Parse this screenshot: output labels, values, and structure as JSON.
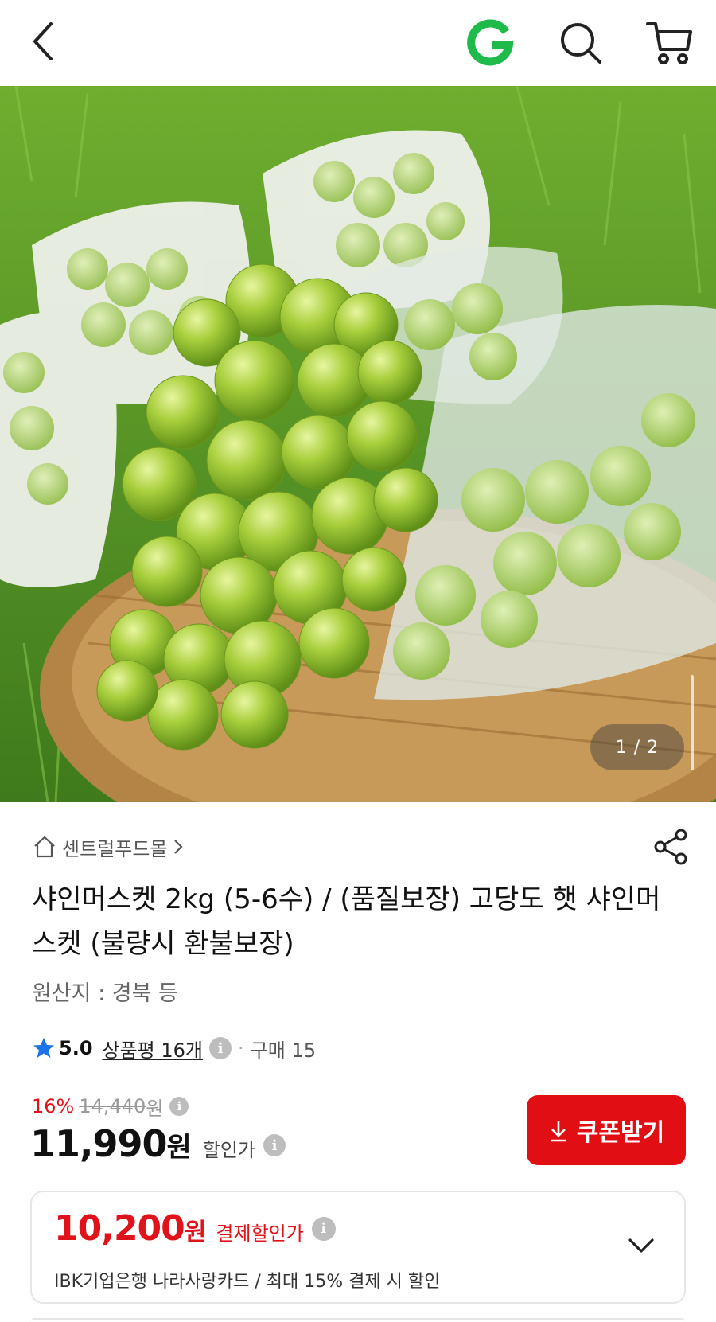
{
  "header": {
    "back_icon": "chevron-left-icon",
    "logo_icon": "g-logo-icon",
    "search_icon": "search-icon",
    "cart_icon": "cart-icon",
    "logo_color": "#1fbb4a"
  },
  "gallery": {
    "counter": "1 / 2"
  },
  "product": {
    "store_name": "센트럴푸드몰",
    "title": "샤인머스켓 2kg (5-6수) / (품질보장) 고당도 햇 샤인머스켓 (불량시 환불보장)",
    "origin": "원산지 : 경북 등",
    "rating": {
      "score": "5.0",
      "reviews_label": "상품평 16개",
      "purchase_label": "구매 15"
    },
    "pricing": {
      "discount_percent": "16%",
      "original_price": "14,440",
      "original_unit": "원",
      "price": "11,990",
      "price_unit": "원",
      "price_label": "할인가"
    },
    "coupon_button": "쿠폰받기",
    "payment_discount": {
      "amount": "10,200",
      "unit": "원",
      "label": "결제할인가",
      "description": "IBK기업은행 나라사랑카드 / 최대 15% 결제 시 할인"
    }
  },
  "colors": {
    "accent_red": "#e10f14",
    "star_blue": "#1a73e8"
  }
}
